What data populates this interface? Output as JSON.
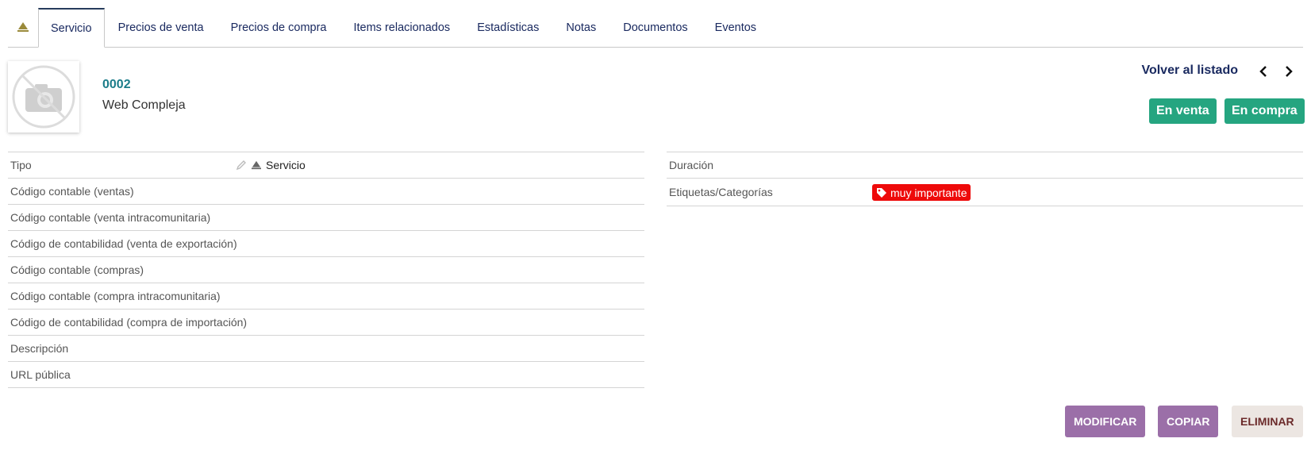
{
  "tabs": [
    {
      "label": "Servicio",
      "active": true
    },
    {
      "label": "Precios de venta"
    },
    {
      "label": "Precios de compra"
    },
    {
      "label": "Items relacionados"
    },
    {
      "label": "Estadísticas"
    },
    {
      "label": "Notas"
    },
    {
      "label": "Documentos"
    },
    {
      "label": "Eventos"
    }
  ],
  "product": {
    "ref": "0002",
    "label": "Web Compleja"
  },
  "header": {
    "back_label": "Volver al listado",
    "status_sell": "En venta",
    "status_buy": "En compra"
  },
  "left_fields": [
    {
      "label": "Tipo",
      "value": "Servicio"
    },
    {
      "label": "Código contable (ventas)"
    },
    {
      "label": "Código contable (venta intracomunitaria)"
    },
    {
      "label": "Código de contabilidad (venta de exportación)"
    },
    {
      "label": "Código contable (compras)"
    },
    {
      "label": "Código contable (compra intracomunitaria)"
    },
    {
      "label": "Código de contabilidad (compra de importación)"
    },
    {
      "label": "Descripción"
    },
    {
      "label": "URL pública"
    }
  ],
  "right_fields": [
    {
      "label": "Duración"
    },
    {
      "label": "Etiquetas/Categorías",
      "tag": "muy importante"
    }
  ],
  "actions": {
    "modify": "MODIFICAR",
    "copy": "COPIAR",
    "delete": "ELIMINAR"
  },
  "colors": {
    "accent_navy": "#1a2a60",
    "ref_teal": "#1c7d8a",
    "status_green": "#25a580",
    "tag_red": "#ee0a0a",
    "action_purple": "#9b6fa8",
    "delete_bg": "#ece6e2"
  },
  "icons": {
    "service_tab": "concierge-bell-icon",
    "photo_placeholder": "no-photo-icon",
    "prev": "chevron-left-icon",
    "next": "chevron-right-icon",
    "edit": "pencil-icon",
    "tag": "tag-icon"
  }
}
